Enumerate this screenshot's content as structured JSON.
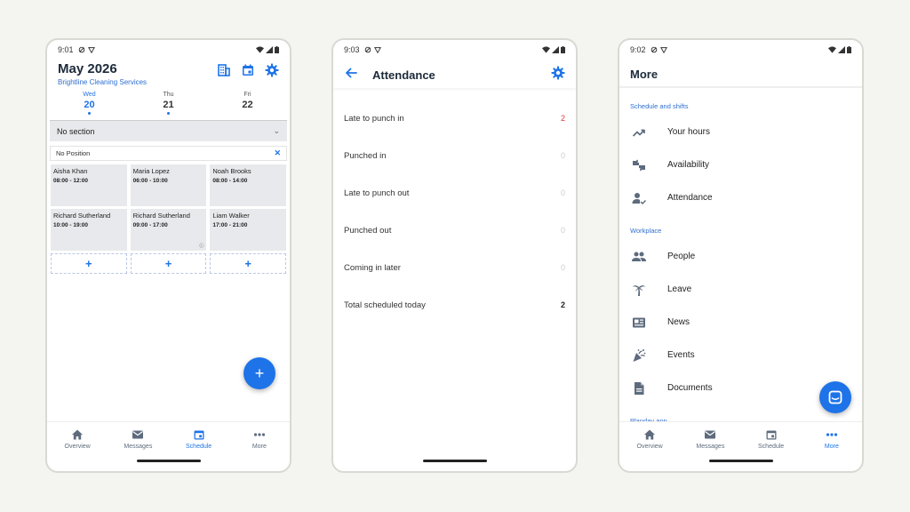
{
  "colors": {
    "accent": "#1e73e8",
    "red": "#e53935",
    "background": "#f4f4f0"
  },
  "phone1": {
    "status_time": "9:01",
    "title": "May 2026",
    "subtitle": "Brightline Cleaning Services",
    "days": [
      {
        "name": "Wed",
        "date": "20",
        "selected": true,
        "dot": true
      },
      {
        "name": "Thu",
        "date": "21",
        "selected": false,
        "dot": true
      },
      {
        "name": "Fri",
        "date": "22",
        "selected": false,
        "dot": false
      }
    ],
    "section_label": "No section",
    "position_label": "No Position",
    "shifts": [
      {
        "name": "Aisha Khan",
        "time": "08:00 - 12:00"
      },
      {
        "name": "Maria Lopez",
        "time": "06:00 - 10:00"
      },
      {
        "name": "Noah Brooks",
        "time": "08:00 - 14:00"
      },
      {
        "name": "Richard Sutherland",
        "time": "10:00 - 19:00"
      },
      {
        "name": "Richard Sutherland",
        "time": "09:00 - 17:00"
      },
      {
        "name": "Liam Walker",
        "time": "17:00 - 21:00"
      }
    ],
    "add_symbol": "+",
    "fab_symbol": "+"
  },
  "phone2": {
    "status_time": "9:03",
    "title": "Attendance",
    "rows": [
      {
        "label": "Late to punch in",
        "value": "2",
        "style": "red"
      },
      {
        "label": "Punched in",
        "value": "0",
        "style": "muted"
      },
      {
        "label": "Late to punch out",
        "value": "0",
        "style": "muted"
      },
      {
        "label": "Punched out",
        "value": "0",
        "style": "muted"
      },
      {
        "label": "Coming in later",
        "value": "0",
        "style": "muted"
      },
      {
        "label": "Total scheduled today",
        "value": "2",
        "style": "dark"
      }
    ]
  },
  "phone3": {
    "status_time": "9:02",
    "title": "More",
    "sections": {
      "schedule": "Schedule and shifts",
      "workplace": "Workplace",
      "planday": "Planday app"
    },
    "items": [
      {
        "label": "Your hours",
        "icon": "trending-up-icon"
      },
      {
        "label": "Availability",
        "icon": "thumbs-icon"
      },
      {
        "label": "Attendance",
        "icon": "person-check-icon"
      },
      {
        "label": "People",
        "icon": "people-icon"
      },
      {
        "label": "Leave",
        "icon": "palm-tree-icon"
      },
      {
        "label": "News",
        "icon": "newspaper-icon"
      },
      {
        "label": "Events",
        "icon": "party-icon"
      },
      {
        "label": "Documents",
        "icon": "document-icon"
      }
    ]
  },
  "tabbar": {
    "overview": "Overview",
    "messages": "Messages",
    "schedule": "Schedule",
    "more": "More"
  }
}
